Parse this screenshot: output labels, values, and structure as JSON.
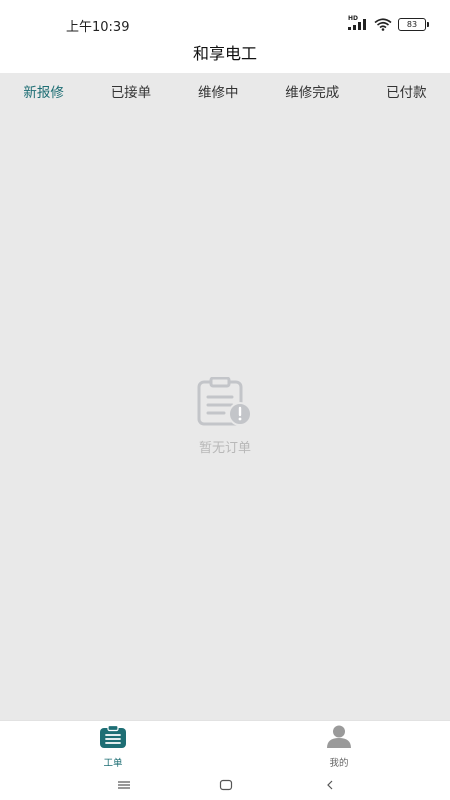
{
  "status_bar": {
    "time": "上午10:39",
    "signal_tag": "HD",
    "battery": "83"
  },
  "app": {
    "title": "和享电工"
  },
  "tabs": [
    {
      "label": "新报修",
      "active": true
    },
    {
      "label": "已接单",
      "active": false
    },
    {
      "label": "维修中",
      "active": false
    },
    {
      "label": "维修完成",
      "active": false
    },
    {
      "label": "已付款",
      "active": false
    }
  ],
  "empty_state": {
    "message": "暂无订单",
    "icon": "clipboard-alert-icon"
  },
  "bottom_nav": [
    {
      "label": "工单",
      "icon": "work-order-icon",
      "active": true
    },
    {
      "label": "我的",
      "icon": "profile-icon",
      "active": false
    }
  ],
  "system_nav": {
    "icons": [
      "menu-icon",
      "home-icon",
      "back-icon"
    ]
  },
  "colors": {
    "accent": "#1e6e74",
    "background": "#e9e9e9",
    "empty_icon": "#c3c5c9"
  }
}
